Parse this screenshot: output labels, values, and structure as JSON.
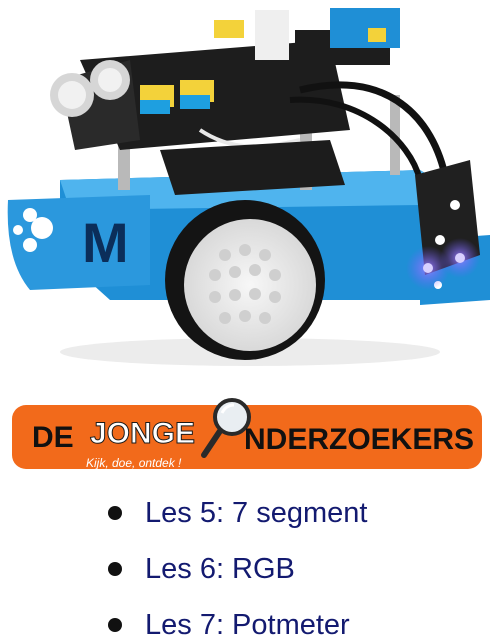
{
  "colors": {
    "banner_orange": "#f26a1b",
    "lesson_text": "#131a70",
    "robot_blue": "#1f8fd6"
  },
  "photo": {
    "subject": "robot-car",
    "icons": [
      "robot-photo-icon"
    ],
    "chassis_letter": "M"
  },
  "logo": {
    "word_1": "DE",
    "word_2": "JONGE",
    "word_3": "NDERZOEKERS",
    "tagline": "Kijk, doe, ontdek !",
    "icon": "magnifier-icon"
  },
  "lessons": [
    {
      "label": "Les 5: 7 segment"
    },
    {
      "label": "Les 6: RGB"
    },
    {
      "label": "Les 7: Potmeter"
    }
  ]
}
